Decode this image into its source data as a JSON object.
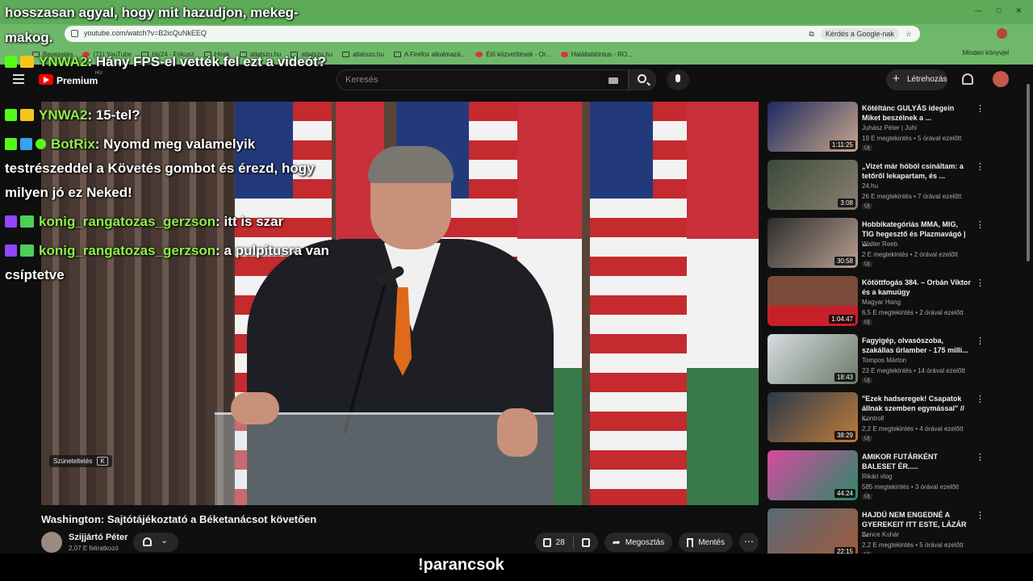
{
  "browser": {
    "url": "youtube.com/watch?v=B2icQuNkEEQ",
    "ask_google": "Kérdés a Google-nak",
    "bookmarks": [
      "Bevezetés",
      "(71) YouTube",
      "Hír24 - Fókusz",
      "Hírek",
      "atlatszo.hu",
      "atlatszo.hu",
      "atlatszo.hu",
      "A Firefox alkalmazá...",
      "Élő közvetítések - Or...",
      "Halállabirintus - RO..."
    ],
    "bookmarks_more": "Minden könyvjel"
  },
  "youtube": {
    "premium": "Premium",
    "region": "HU",
    "search_placeholder": "Keresés",
    "create_label": "Létrehozás"
  },
  "video": {
    "pause_tip": "Szüneteltetés",
    "pause_key": "K",
    "title": "Washington: Sajtótájékoztató a Béketanácsot követően",
    "channel": "Szijjártó Péter",
    "subscribers": "2,07 E feliratkozó",
    "likes": "28",
    "share": "Megosztás",
    "save": "Mentés"
  },
  "recommendations": [
    {
      "title": "Kötéltánc GULYÁS idegein Miket beszélnek a ...",
      "channel": "Juhász Péter | Juhi",
      "meta": "19 E megtekintés • 5 órával ezelőtt",
      "badge": "Új",
      "duration": "1:11:25"
    },
    {
      "title": "„Vizet már hóból csináltam: a tetőről lekapartam, és ...",
      "channel": "24.hu",
      "meta": "26 E megtekintés • 7 órával ezelőtt",
      "badge": "Új",
      "duration": "3:08"
    },
    {
      "title": "Hobbikategóriás MMA, MIG, TIG hegesztő és Plazmavágó | ...",
      "channel": "Walter Reeb",
      "meta": "2 E megtekintés • 2 órával ezelőtt",
      "badge": "Új",
      "duration": "30:58"
    },
    {
      "title": "Kötöttfogás 384. – Orbán Viktor és a kamuügy",
      "channel": "Magyar Hang",
      "meta": "6,5 E megtekintés • 2 órával ezelőtt",
      "badge": "Új",
      "duration": "1:04:47"
    },
    {
      "title": "Fagyigép, olvasószoba, szakállas űrlamber - 175 milli...",
      "channel": "Tompos Márton",
      "meta": "23 E megtekintés • 14 órával ezelőtt",
      "badge": "Új",
      "duration": "18:43"
    },
    {
      "title": "\"Ezek hadseregek! Csapatok állnak szemben egymással\" // ...",
      "channel": "Kontroll",
      "meta": "2,2 E megtekintés • 4 órával ezelőtt",
      "badge": "Új",
      "duration": "38:29"
    },
    {
      "title": "AMIKOR FUTÁRKÉNT BALESET ÉR.....",
      "channel": "Rikári vlog",
      "meta": "585 megtekintés • 3 órával ezelőtt",
      "badge": "Új",
      "duration": "44:24"
    },
    {
      "title": "HAJDÚ NEM ENGEDNÉ A GYEREKEIT ITT ESTE, LÁZÁR ...",
      "channel": "Bence Kuhár",
      "meta": "2,2 E megtekintés • 5 órával ezelőtt",
      "badge": "Új",
      "duration": "22:15"
    }
  ],
  "overlay": {
    "top_text": "hosszasan agyal, hogy mit hazudjon, mekeg-makog.",
    "messages": [
      {
        "user": "YNWA2",
        "text": ": Hány FPS-el vették fel ezt a videót?"
      },
      {
        "user": "YNWA2",
        "text": ": 15-tel?"
      },
      {
        "user": "BotRix",
        "text": ": Nyomd meg valamelyik testrészeddel a Követés gombot és érezd, hogy milyen jó ez Neked!"
      },
      {
        "user": "konig_rangatozas_gerzson",
        "text": ": itt is szar"
      },
      {
        "user": "konig_rangatozas_gerzson",
        "text": ": a pulpitusra van csíptetve"
      }
    ],
    "bottom_command": "!parancsok"
  }
}
